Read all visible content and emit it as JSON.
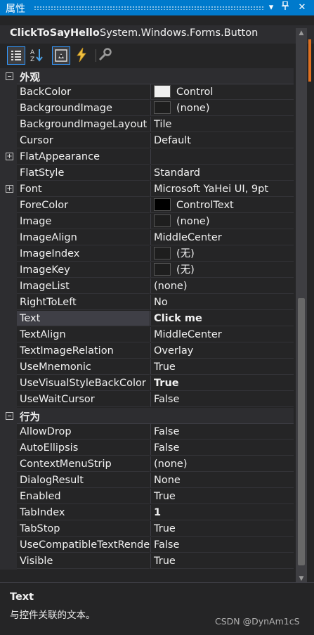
{
  "panel": {
    "title": "属性",
    "pin_icon": "pin-icon",
    "close_icon": "close-icon",
    "dropdown_icon": "chevron-down-icon"
  },
  "selector": {
    "object_name": "ClickToSayHello",
    "object_type": "System.Windows.Forms.Button"
  },
  "toolbar": {
    "buttons": [
      {
        "icon": "categorized-icon",
        "active": true
      },
      {
        "icon": "alphabetical-icon",
        "active": false
      },
      {
        "icon": "properties-icon",
        "active": true
      },
      {
        "icon": "events-icon",
        "active": false
      },
      {
        "icon": "property-pages-icon",
        "active": false
      }
    ]
  },
  "categories": [
    {
      "label": "外观",
      "properties": [
        {
          "name": "BackColor",
          "value": "Control",
          "swatch": "#f0f0f0"
        },
        {
          "name": "BackgroundImage",
          "value": "(none)",
          "swatch": "#1e1e1e"
        },
        {
          "name": "BackgroundImageLayout",
          "value": "Tile"
        },
        {
          "name": "Cursor",
          "value": "Default"
        },
        {
          "name": "FlatAppearance",
          "value": "",
          "expandable": true
        },
        {
          "name": "FlatStyle",
          "value": "Standard"
        },
        {
          "name": "Font",
          "value": "Microsoft YaHei UI, 9pt",
          "expandable": true
        },
        {
          "name": "ForeColor",
          "value": "ControlText",
          "swatch": "#000000"
        },
        {
          "name": "Image",
          "value": "(none)",
          "swatch": "#1e1e1e"
        },
        {
          "name": "ImageAlign",
          "value": "MiddleCenter"
        },
        {
          "name": "ImageIndex",
          "value": "(无)",
          "swatch": "#1e1e1e"
        },
        {
          "name": "ImageKey",
          "value": "(无)",
          "swatch": "#1e1e1e"
        },
        {
          "name": "ImageList",
          "value": "(none)"
        },
        {
          "name": "RightToLeft",
          "value": "No"
        },
        {
          "name": "Text",
          "value": "Click me",
          "bold": true,
          "selected": true
        },
        {
          "name": "TextAlign",
          "value": "MiddleCenter"
        },
        {
          "name": "TextImageRelation",
          "value": "Overlay"
        },
        {
          "name": "UseMnemonic",
          "value": "True"
        },
        {
          "name": "UseVisualStyleBackColor",
          "value": "True",
          "bold": true
        },
        {
          "name": "UseWaitCursor",
          "value": "False"
        }
      ]
    },
    {
      "label": "行为",
      "properties": [
        {
          "name": "AllowDrop",
          "value": "False"
        },
        {
          "name": "AutoEllipsis",
          "value": "False"
        },
        {
          "name": "ContextMenuStrip",
          "value": "(none)"
        },
        {
          "name": "DialogResult",
          "value": "None"
        },
        {
          "name": "Enabled",
          "value": "True"
        },
        {
          "name": "TabIndex",
          "value": "1",
          "bold": true
        },
        {
          "name": "TabStop",
          "value": "True"
        },
        {
          "name": "UseCompatibleTextRendering",
          "value": "False"
        },
        {
          "name": "Visible",
          "value": "True"
        }
      ]
    }
  ],
  "description": {
    "title": "Text",
    "text": "与控件关联的文本。"
  },
  "watermark": "CSDN @DynAm1cS"
}
